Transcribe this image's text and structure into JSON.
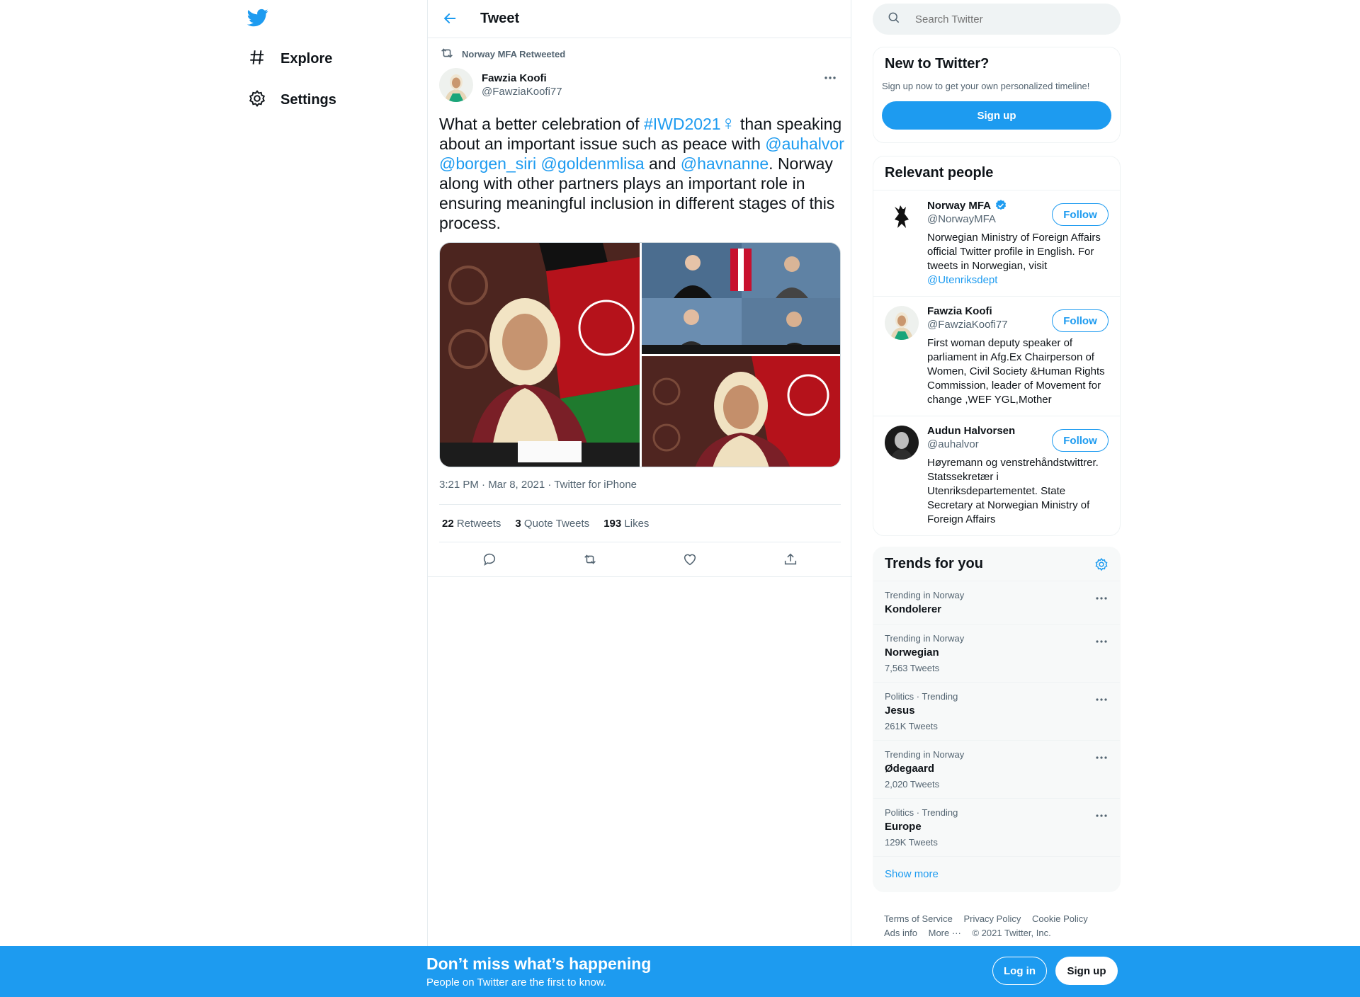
{
  "nav": {
    "logo": "twitter-bird-icon",
    "items": [
      {
        "label": "Explore",
        "icon": "hashtag-icon"
      },
      {
        "label": "Settings",
        "icon": "gear-icon"
      }
    ]
  },
  "header": {
    "title": "Tweet",
    "back_icon": "back-arrow-icon"
  },
  "tweet": {
    "retweeted_by": "Norway MFA Retweeted",
    "author_name": "Fawzia Koofi",
    "author_handle": "@FawziaKoofi77",
    "text_parts": [
      "What a better celebration of ",
      "#IWD2021",
      "♀",
      " than speaking about an important issue such as peace with ",
      "@auhalvor",
      " ",
      "@borgen_siri",
      " ",
      "@goldenmlisa",
      " and ",
      "@havnanne",
      ". Norway along with other partners plays an important role in ensuring meaningful inclusion in different stages of this process."
    ],
    "timestamp": "3:21 PM · Mar 8, 2021 · Twitter for iPhone",
    "retweets": {
      "count": "22",
      "label": "Retweets"
    },
    "quotes": {
      "count": "3",
      "label": "Quote Tweets"
    },
    "likes": {
      "count": "193",
      "label": "Likes"
    }
  },
  "search": {
    "placeholder": "Search Twitter"
  },
  "new_to_twitter": {
    "title": "New to Twitter?",
    "subtitle": "Sign up now to get your own personalized timeline!",
    "button": "Sign up"
  },
  "relevant": {
    "title": "Relevant people",
    "people": [
      {
        "name": "Norway MFA",
        "handle": "@NorwayMFA",
        "verified": true,
        "bio": "Norwegian Ministry of Foreign Affairs official Twitter profile in English. For tweets in Norwegian, visit ",
        "bio_link": "@Utenriksdept",
        "button": "Follow"
      },
      {
        "name": "Fawzia Koofi",
        "handle": "@FawziaKoofi77",
        "bio": "First woman deputy speaker of parliament in Afg.Ex Chairperson of Women, Civil Society &Human Rights Commission, leader of Movement for change ,WEF YGL,Mother",
        "button": "Follow"
      },
      {
        "name": "Audun Halvorsen",
        "handle": "@auhalvor",
        "bio": "Høyremann og venstrehåndstwittrer. Statssekretær i Utenriksdepartementet. State Secretary at Norwegian Ministry of Foreign Affairs",
        "button": "Follow"
      }
    ]
  },
  "trends": {
    "title": "Trends for you",
    "items": [
      {
        "context": "Trending in Norway",
        "name": "Kondolerer",
        "count": ""
      },
      {
        "context": "Trending in Norway",
        "name": "Norwegian",
        "count": "7,563 Tweets"
      },
      {
        "context": "Politics · Trending",
        "name": "Jesus",
        "count": "261K Tweets"
      },
      {
        "context": "Trending in Norway",
        "name": "Ødegaard",
        "count": "2,020 Tweets"
      },
      {
        "context": "Politics · Trending",
        "name": "Europe",
        "count": "129K Tweets"
      }
    ],
    "show_more": "Show more"
  },
  "footer": {
    "links": [
      "Terms of Service",
      "Privacy Policy",
      "Cookie Policy",
      "Ads info",
      "More ···"
    ],
    "copyright": "© 2021 Twitter, Inc."
  },
  "banner": {
    "title": "Don’t miss what’s happening",
    "subtitle": "People on Twitter are the first to know.",
    "login": "Log in",
    "signup": "Sign up"
  },
  "colors": {
    "accent": "#1d9bf0",
    "text": "#0f1419",
    "secondary": "#536471"
  }
}
